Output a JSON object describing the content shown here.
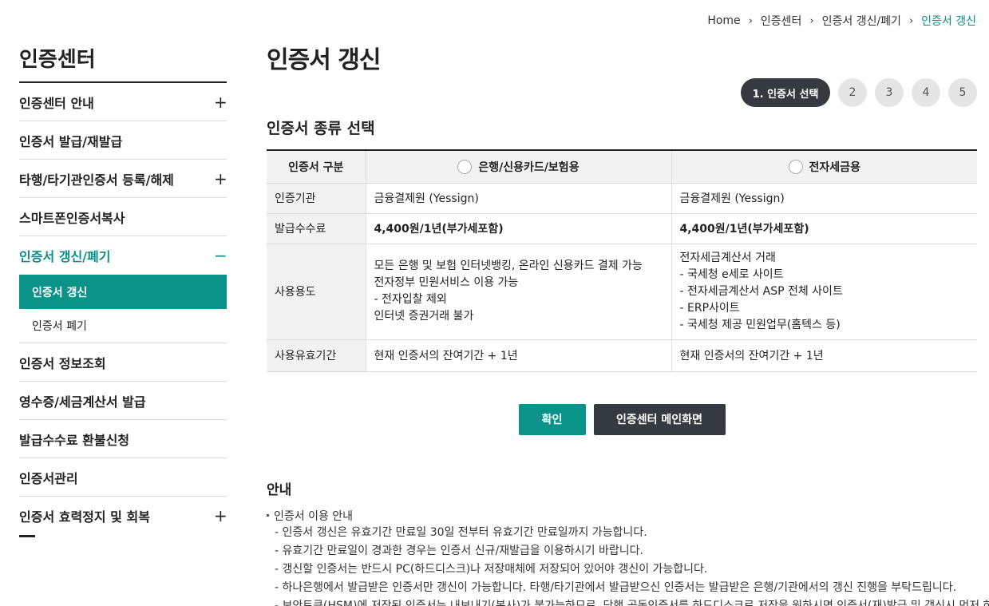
{
  "breadcrumb": [
    "Home",
    "인증센터",
    "인증서 갱신/폐기",
    "인증서 갱신"
  ],
  "sidebar": {
    "title": "인증센터",
    "items": [
      {
        "label": "인증센터 안내",
        "toggle": "+"
      },
      {
        "label": "인증서 발급/재발급",
        "toggle": ""
      },
      {
        "label": "타행/타기관인증서 등록/해제",
        "toggle": "+"
      },
      {
        "label": "스마트폰인증서복사",
        "toggle": ""
      },
      {
        "label": "인증서 갱신/폐기",
        "toggle": "−"
      },
      {
        "label": "인증서 정보조회",
        "toggle": ""
      },
      {
        "label": "영수증/세금계산서 발급",
        "toggle": ""
      },
      {
        "label": "발급수수료 환불신청",
        "toggle": ""
      },
      {
        "label": "인증서관리",
        "toggle": ""
      },
      {
        "label": "인증서 효력정지 및 회복",
        "toggle": "+"
      }
    ],
    "subitems": [
      "인증서 갱신",
      "인증서 폐기"
    ]
  },
  "main": {
    "title": "인증서 갱신",
    "steps": [
      "1. 인증서 선택",
      "2",
      "3",
      "4",
      "5"
    ],
    "section_title": "인증서 종류 선택"
  },
  "table": {
    "header": {
      "label": "인증서 구분",
      "col1": "은행/신용카드/보험용",
      "col2": "전자세금용"
    },
    "rows": [
      {
        "label": "인증기관",
        "col1": "금융결제원 (Yessign)",
        "col2": "금융결제원 (Yessign)"
      },
      {
        "label": "발급수수료",
        "col1": "4,400원/1년(부가세포함)",
        "col2": "4,400원/1년(부가세포함)"
      },
      {
        "label": "사용용도",
        "col1": [
          "모든 은행 및 보험 인터넷뱅킹, 온라인 신용카드 결제 가능",
          "전자정부 민원서비스 이용 가능",
          "- 전자입찰 제외",
          "인터넷 증권거래 불가"
        ],
        "col2": [
          "전자세금계산서 거래",
          "- 국세청 e세로 사이트",
          "- 전자세금계산서 ASP 전체 사이트",
          "- ERP사이트",
          "- 국세청 제공 민원업무(홈텍스 등)"
        ]
      },
      {
        "label": "사용유효기간",
        "col1": "현재 인증서의 잔여기간 + 1년",
        "col2": "현재 인증서의 잔여기간 + 1년"
      }
    ]
  },
  "buttons": {
    "confirm": "확인",
    "main": "인증센터 메인화면"
  },
  "guide": {
    "title": "안내",
    "head": "인증서 이용 안내",
    "items": [
      "- 인증서 갱신은 유효기간 만료일 30일 전부터 유효기간 만료일까지 가능합니다.",
      "- 유효기간 만료일이 경과한 경우는 인증서 신규/재발급을 이용하시기 바랍니다.",
      "- 갱신할 인증서는 반드시 PC(하드디스크)나 저장매체에 저장되어 있어야 갱신이 가능합니다.",
      "- 하나은행에서 발급받은 인증서만 갱신이 가능합니다. 타행/타기관에서 발급받으신 인증서는 발급받은 은행/기관에서의 갱신 진행을 부탁드립니다.",
      "- 보안토큰(HSM)에 저장된 인증서는 내보내기(복사)가 불가능하므로, 당행 공동인증서를 하드디스크로 저장을 원하시면 인증서(재)발급 및 갱신시 먼저 하"
    ]
  }
}
